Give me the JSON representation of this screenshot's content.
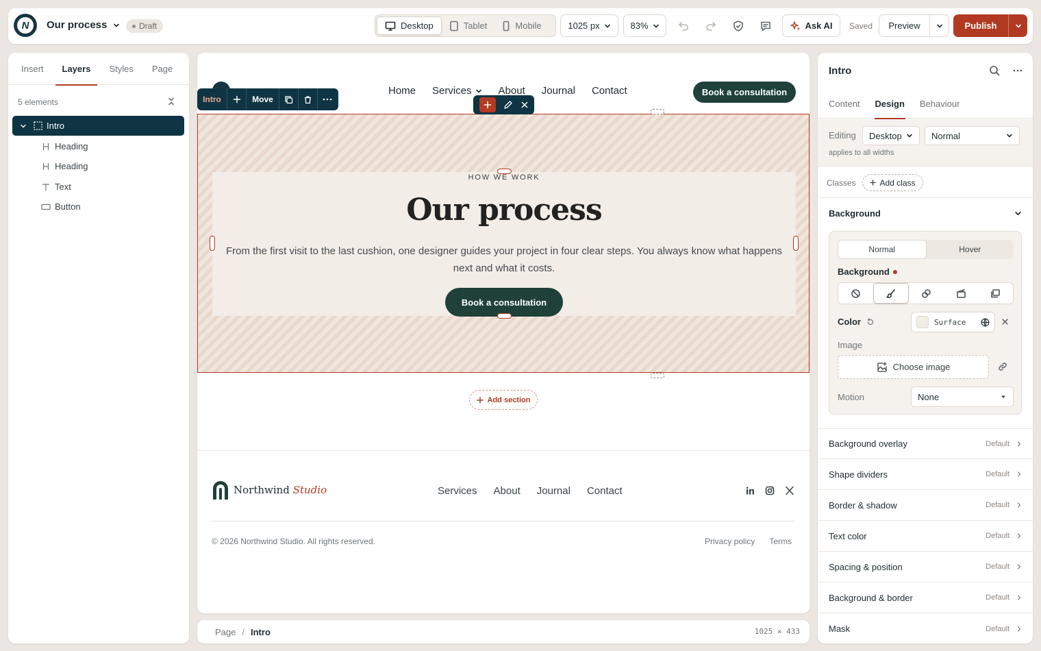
{
  "topbar": {
    "page_title": "Our process",
    "status": "Draft",
    "devices": [
      {
        "label": "Desktop",
        "icon": "desktop-icon",
        "active": true
      },
      {
        "label": "Tablet",
        "icon": "tablet-icon",
        "active": false
      },
      {
        "label": "Mobile",
        "icon": "mobile-icon",
        "active": false
      }
    ],
    "width_value": "1025 px",
    "zoom_value": "83%",
    "ask_ai_label": "Ask AI",
    "saved_label": "Saved",
    "preview_label": "Preview",
    "publish_label": "Publish",
    "accent_color": "#b23a22",
    "brand_color": "#163642"
  },
  "left_panel": {
    "tabs": [
      "Insert",
      "Layers",
      "Styles",
      "Page"
    ],
    "active_tab": "Layers",
    "count_label": "5 elements",
    "layers": [
      {
        "label": "Intro",
        "icon": "section-icon",
        "selected": true,
        "expanded": true
      },
      {
        "label": "Heading",
        "icon": "heading-icon",
        "selected": false
      },
      {
        "label": "Heading",
        "icon": "heading-icon",
        "selected": false
      },
      {
        "label": "Text",
        "icon": "text-icon",
        "selected": false
      },
      {
        "label": "Button",
        "icon": "button-icon",
        "selected": false
      }
    ]
  },
  "canvas": {
    "nav": {
      "links": [
        "Home",
        "Services",
        "About",
        "Journal",
        "Contact"
      ],
      "cta": "Book a consultation"
    },
    "selection_toolbar": {
      "name": "Intro",
      "move_label": "Move"
    },
    "section": {
      "eyebrow": "HOW WE WORK",
      "heading": "Our process",
      "paragraph": "From the first visit to the last cushion, one designer guides your project in four clear steps. You always know what happens next and what it costs.",
      "cta": "Book a consultation"
    },
    "add_section_label": "Add section",
    "footer": {
      "brand": "Northwind",
      "brand_accent": "Studio",
      "links": [
        "Services",
        "About",
        "Journal",
        "Contact"
      ],
      "copyright": "© 2026 Northwind Studio. All rights reserved.",
      "legal": [
        "Privacy policy",
        "Terms"
      ]
    }
  },
  "breadcrumb": {
    "root": "Page",
    "current": "Intro",
    "dims_w": "1025",
    "dims_sep": "×",
    "dims_h": "433"
  },
  "right_panel": {
    "title": "Intro",
    "tabs": [
      "Content",
      "Design",
      "Behaviour"
    ],
    "active_tab": "Design",
    "editing_label": "Editing",
    "editing_device": "Desktop",
    "editing_state": "Normal",
    "applies_note": "applies to all widths",
    "classes_label": "Classes",
    "add_class_label": "Add class",
    "background": {
      "section_label": "Background",
      "states": [
        "Normal",
        "Hover"
      ],
      "active_state": "Normal",
      "field_label": "Background",
      "types": [
        "none-icon",
        "brush-icon",
        "gradient-icon",
        "video-icon",
        "slideshow-icon"
      ],
      "active_type": "brush-icon",
      "color_label": "Color",
      "color_value": "Surface",
      "color_swatch": "#f2ede7",
      "image_label": "Image",
      "choose_image_label": "Choose image",
      "motion_label": "Motion",
      "motion_value": "None"
    },
    "rows": [
      {
        "label": "Background overlay",
        "value": "Default"
      },
      {
        "label": "Shape dividers",
        "value": "Default"
      },
      {
        "label": "Border & shadow",
        "value": "Default"
      },
      {
        "label": "Text color",
        "value": "Default"
      },
      {
        "label": "Spacing & position",
        "value": "Default"
      },
      {
        "label": "Background & border",
        "value": "Default"
      },
      {
        "label": "Mask",
        "value": "Default"
      }
    ]
  }
}
